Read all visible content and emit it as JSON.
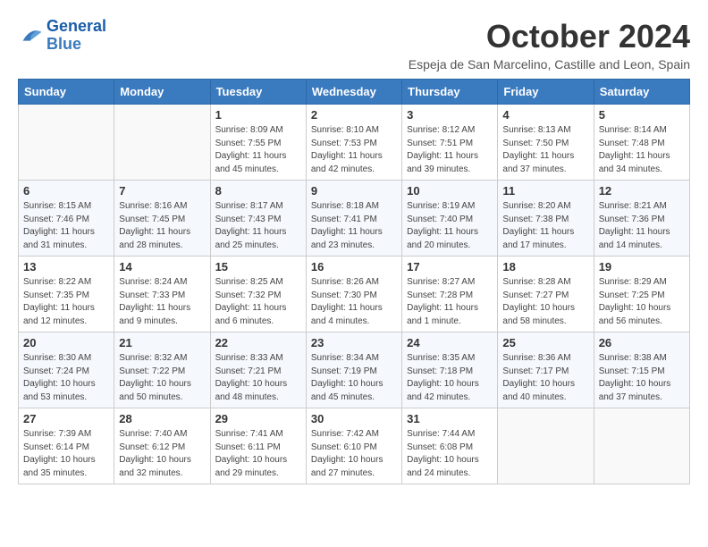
{
  "logo": {
    "line1": "General",
    "line2": "Blue"
  },
  "title": "October 2024",
  "subtitle": "Espeja de San Marcelino, Castille and Leon, Spain",
  "days_header": [
    "Sunday",
    "Monday",
    "Tuesday",
    "Wednesday",
    "Thursday",
    "Friday",
    "Saturday"
  ],
  "weeks": [
    [
      {
        "day": "",
        "info": ""
      },
      {
        "day": "",
        "info": ""
      },
      {
        "day": "1",
        "info": "Sunrise: 8:09 AM\nSunset: 7:55 PM\nDaylight: 11 hours and 45 minutes."
      },
      {
        "day": "2",
        "info": "Sunrise: 8:10 AM\nSunset: 7:53 PM\nDaylight: 11 hours and 42 minutes."
      },
      {
        "day": "3",
        "info": "Sunrise: 8:12 AM\nSunset: 7:51 PM\nDaylight: 11 hours and 39 minutes."
      },
      {
        "day": "4",
        "info": "Sunrise: 8:13 AM\nSunset: 7:50 PM\nDaylight: 11 hours and 37 minutes."
      },
      {
        "day": "5",
        "info": "Sunrise: 8:14 AM\nSunset: 7:48 PM\nDaylight: 11 hours and 34 minutes."
      }
    ],
    [
      {
        "day": "6",
        "info": "Sunrise: 8:15 AM\nSunset: 7:46 PM\nDaylight: 11 hours and 31 minutes."
      },
      {
        "day": "7",
        "info": "Sunrise: 8:16 AM\nSunset: 7:45 PM\nDaylight: 11 hours and 28 minutes."
      },
      {
        "day": "8",
        "info": "Sunrise: 8:17 AM\nSunset: 7:43 PM\nDaylight: 11 hours and 25 minutes."
      },
      {
        "day": "9",
        "info": "Sunrise: 8:18 AM\nSunset: 7:41 PM\nDaylight: 11 hours and 23 minutes."
      },
      {
        "day": "10",
        "info": "Sunrise: 8:19 AM\nSunset: 7:40 PM\nDaylight: 11 hours and 20 minutes."
      },
      {
        "day": "11",
        "info": "Sunrise: 8:20 AM\nSunset: 7:38 PM\nDaylight: 11 hours and 17 minutes."
      },
      {
        "day": "12",
        "info": "Sunrise: 8:21 AM\nSunset: 7:36 PM\nDaylight: 11 hours and 14 minutes."
      }
    ],
    [
      {
        "day": "13",
        "info": "Sunrise: 8:22 AM\nSunset: 7:35 PM\nDaylight: 11 hours and 12 minutes."
      },
      {
        "day": "14",
        "info": "Sunrise: 8:24 AM\nSunset: 7:33 PM\nDaylight: 11 hours and 9 minutes."
      },
      {
        "day": "15",
        "info": "Sunrise: 8:25 AM\nSunset: 7:32 PM\nDaylight: 11 hours and 6 minutes."
      },
      {
        "day": "16",
        "info": "Sunrise: 8:26 AM\nSunset: 7:30 PM\nDaylight: 11 hours and 4 minutes."
      },
      {
        "day": "17",
        "info": "Sunrise: 8:27 AM\nSunset: 7:28 PM\nDaylight: 11 hours and 1 minute."
      },
      {
        "day": "18",
        "info": "Sunrise: 8:28 AM\nSunset: 7:27 PM\nDaylight: 10 hours and 58 minutes."
      },
      {
        "day": "19",
        "info": "Sunrise: 8:29 AM\nSunset: 7:25 PM\nDaylight: 10 hours and 56 minutes."
      }
    ],
    [
      {
        "day": "20",
        "info": "Sunrise: 8:30 AM\nSunset: 7:24 PM\nDaylight: 10 hours and 53 minutes."
      },
      {
        "day": "21",
        "info": "Sunrise: 8:32 AM\nSunset: 7:22 PM\nDaylight: 10 hours and 50 minutes."
      },
      {
        "day": "22",
        "info": "Sunrise: 8:33 AM\nSunset: 7:21 PM\nDaylight: 10 hours and 48 minutes."
      },
      {
        "day": "23",
        "info": "Sunrise: 8:34 AM\nSunset: 7:19 PM\nDaylight: 10 hours and 45 minutes."
      },
      {
        "day": "24",
        "info": "Sunrise: 8:35 AM\nSunset: 7:18 PM\nDaylight: 10 hours and 42 minutes."
      },
      {
        "day": "25",
        "info": "Sunrise: 8:36 AM\nSunset: 7:17 PM\nDaylight: 10 hours and 40 minutes."
      },
      {
        "day": "26",
        "info": "Sunrise: 8:38 AM\nSunset: 7:15 PM\nDaylight: 10 hours and 37 minutes."
      }
    ],
    [
      {
        "day": "27",
        "info": "Sunrise: 7:39 AM\nSunset: 6:14 PM\nDaylight: 10 hours and 35 minutes."
      },
      {
        "day": "28",
        "info": "Sunrise: 7:40 AM\nSunset: 6:12 PM\nDaylight: 10 hours and 32 minutes."
      },
      {
        "day": "29",
        "info": "Sunrise: 7:41 AM\nSunset: 6:11 PM\nDaylight: 10 hours and 29 minutes."
      },
      {
        "day": "30",
        "info": "Sunrise: 7:42 AM\nSunset: 6:10 PM\nDaylight: 10 hours and 27 minutes."
      },
      {
        "day": "31",
        "info": "Sunrise: 7:44 AM\nSunset: 6:08 PM\nDaylight: 10 hours and 24 minutes."
      },
      {
        "day": "",
        "info": ""
      },
      {
        "day": "",
        "info": ""
      }
    ]
  ]
}
